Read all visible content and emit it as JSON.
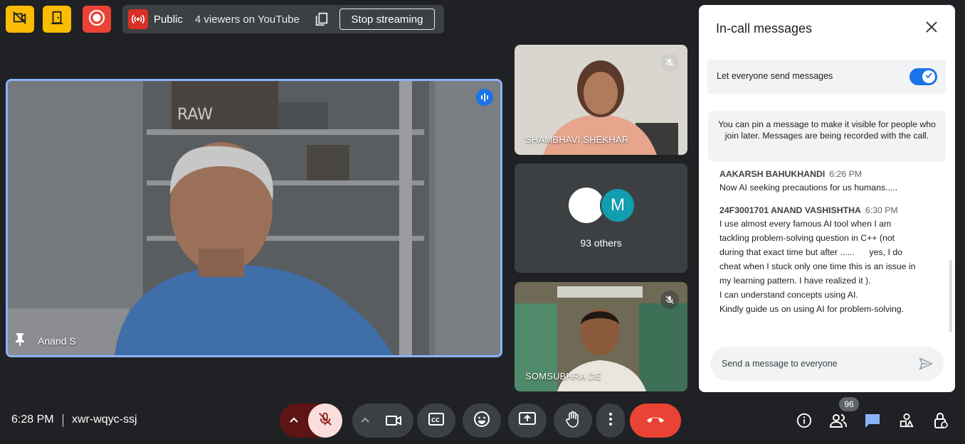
{
  "colors": {
    "accent": "#8ab4f8",
    "warning": "#fbbc04",
    "danger": "#ea4335",
    "muted_mic_bg": "#f9dedc"
  },
  "top_bar": {
    "icons": [
      "camera-off-icon",
      "door-exit-icon",
      "record-icon"
    ],
    "stream": {
      "label": "Public",
      "viewers": "4 viewers on YouTube",
      "stop_button": "Stop streaming"
    }
  },
  "main_tile": {
    "participant": "Anand S"
  },
  "side_tiles": [
    {
      "name": "SHAMBHAVI SHEKHAR",
      "muted": true
    },
    {
      "others_label": "93 others",
      "avatar_letter": "M"
    },
    {
      "name": "SOMSUBHRA DE",
      "muted": true
    }
  ],
  "chat_panel": {
    "title": "In-call messages",
    "toggle_label": "Let everyone send messages",
    "toggle_on": true,
    "info": "You can pin a message to make it visible for people who join later. Messages are being recorded with the call.",
    "messages": [
      {
        "sender": "AAKARSH BAHUKHANDI",
        "time": "6:26 PM",
        "lines": [
          "Now AI seeking precautions for us humans....."
        ]
      },
      {
        "sender": "24F3001701 ANAND VASHISHTHA",
        "time": "6:30 PM",
        "lines": [
          "I use almost every famous AI tool when I am",
          "tackling problem-solving question in C++ (not",
          "during that exact time but after ......      yes, I do",
          "cheat when I stuck only one time this is an issue in",
          "my learning pattern. I have realized it ).",
          "I can understand concepts using AI.",
          "Kindly guide us on using AI for problem-solving."
        ]
      }
    ],
    "input_placeholder": "Send a message to everyone"
  },
  "bottom_bar": {
    "time": "6:28 PM",
    "meeting_code": "xwr-wqyc-ssj",
    "controls": [
      "mic-off-icon",
      "camera-icon",
      "captions-icon",
      "emoji-icon",
      "present-icon",
      "raise-hand-icon",
      "more-options-icon",
      "end-call-icon"
    ],
    "people_count": "96"
  }
}
